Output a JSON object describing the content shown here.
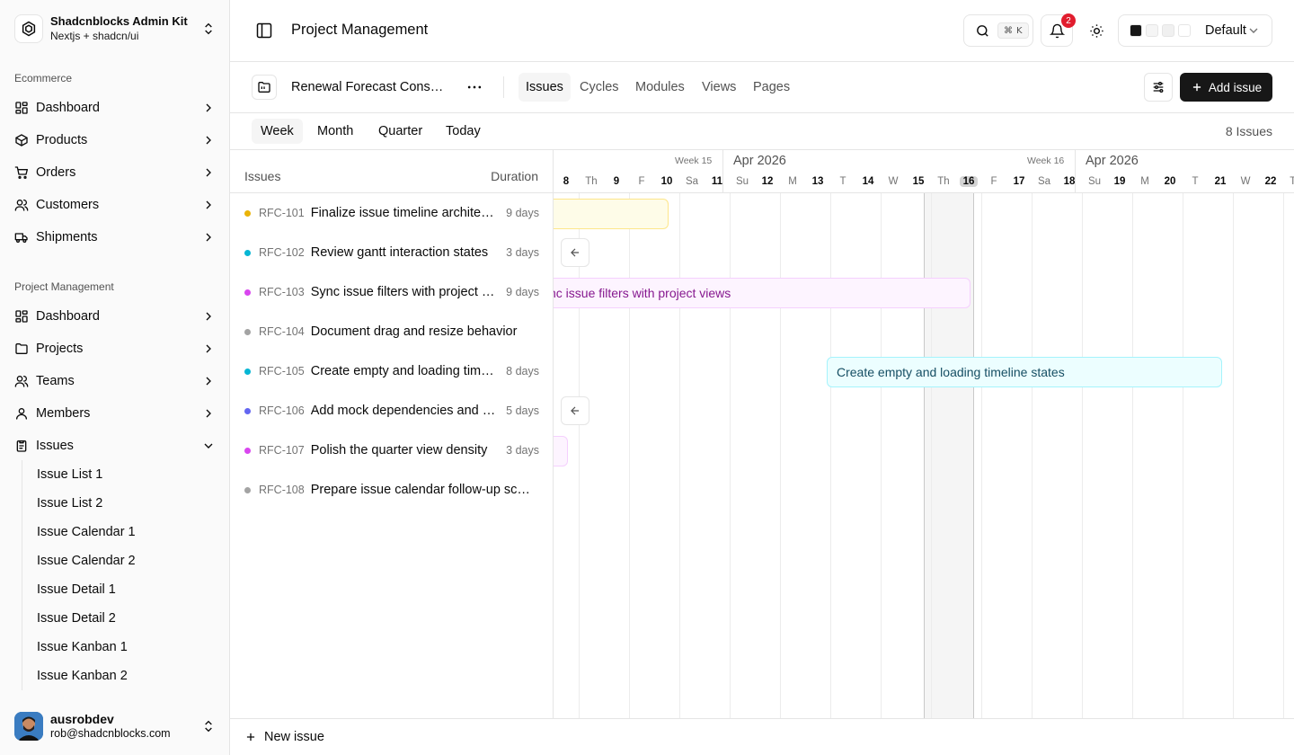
{
  "brand": {
    "title": "Shadcnblocks Admin Kit",
    "subtitle": "Nextjs + shadcn/ui"
  },
  "sidebar": {
    "section1": "Ecommerce",
    "ecommerce": [
      {
        "label": "Dashboard",
        "icon": "layout-dashboard-icon"
      },
      {
        "label": "Products",
        "icon": "package-icon"
      },
      {
        "label": "Orders",
        "icon": "cart-icon"
      },
      {
        "label": "Customers",
        "icon": "users-icon"
      },
      {
        "label": "Shipments",
        "icon": "truck-icon"
      }
    ],
    "section2": "Project Management",
    "pm": [
      {
        "label": "Dashboard",
        "icon": "layout-dashboard-icon"
      },
      {
        "label": "Projects",
        "icon": "folder-icon"
      },
      {
        "label": "Teams",
        "icon": "users-icon"
      },
      {
        "label": "Members",
        "icon": "user-icon"
      },
      {
        "label": "Issues",
        "icon": "clipboard-icon"
      }
    ],
    "issues_sub": [
      "Issue List 1",
      "Issue List 2",
      "Issue Calendar 1",
      "Issue Calendar 2",
      "Issue Detail 1",
      "Issue Detail 2",
      "Issue Kanban 1",
      "Issue Kanban 2"
    ]
  },
  "user": {
    "name": "ausrobdev",
    "email": "rob@shadcnblocks.com"
  },
  "header": {
    "title": "Project Management",
    "kbd_cmd": "⌘",
    "kbd_key": "K",
    "notifications": "2",
    "theme": "Default",
    "swatches": [
      "#171717",
      "#f5f5f5",
      "#f0f0f0",
      "#ffffff"
    ]
  },
  "project": {
    "name": "Renewal Forecast Consolidation",
    "tabs": [
      "Issues",
      "Cycles",
      "Modules",
      "Views",
      "Pages"
    ],
    "add_label": "Add issue"
  },
  "views": {
    "options": [
      "Week",
      "Month",
      "Quarter",
      "Today"
    ],
    "count": "8 Issues"
  },
  "list": {
    "col_issues": "Issues",
    "col_duration": "Duration",
    "rows": [
      {
        "key": "RFC-101",
        "title": "Finalize issue timeline architecture",
        "duration": "9 days",
        "color": "#eab308"
      },
      {
        "key": "RFC-102",
        "title": "Review gantt interaction states",
        "duration": "3 days",
        "color": "#06b6d4"
      },
      {
        "key": "RFC-103",
        "title": "Sync issue filters with project views",
        "duration": "9 days",
        "color": "#d946ef"
      },
      {
        "key": "RFC-104",
        "title": "Document drag and resize behavior",
        "duration": "",
        "color": "#a3a3a3"
      },
      {
        "key": "RFC-105",
        "title": "Create empty and loading timeline states",
        "duration": "8 days",
        "color": "#06b6d4"
      },
      {
        "key": "RFC-106",
        "title": "Add mock dependencies and handoffs",
        "duration": "5 days",
        "color": "#6366f1"
      },
      {
        "key": "RFC-107",
        "title": "Polish the quarter view density",
        "duration": "3 days",
        "color": "#d946ef"
      },
      {
        "key": "RFC-108",
        "title": "Prepare issue calendar follow-up screens",
        "duration": "",
        "color": "#a3a3a3"
      }
    ]
  },
  "timeline": {
    "weeks": [
      {
        "week": "Week 15",
        "month": "Apr 2026"
      },
      {
        "week": "Week 16",
        "month": "Apr 2026"
      }
    ],
    "days": [
      {
        "lbl": "",
        "num": "8"
      },
      {
        "lbl": "Th",
        "num": "9"
      },
      {
        "lbl": "F",
        "num": "10"
      },
      {
        "lbl": "Sa",
        "num": "11"
      },
      {
        "lbl": "Su",
        "num": "12"
      },
      {
        "lbl": "M",
        "num": "13"
      },
      {
        "lbl": "T",
        "num": "14"
      },
      {
        "lbl": "W",
        "num": "15"
      },
      {
        "lbl": "Th",
        "num": "16"
      },
      {
        "lbl": "F",
        "num": "17"
      },
      {
        "lbl": "Sa",
        "num": "18"
      },
      {
        "lbl": "Su",
        "num": "19"
      },
      {
        "lbl": "M",
        "num": "20"
      },
      {
        "lbl": "T",
        "num": "21"
      },
      {
        "lbl": "W",
        "num": "22"
      },
      {
        "lbl": "Th",
        "num": ""
      }
    ],
    "bar_labels": {
      "rfc103": "nc issue filters with project views",
      "rfc105": "Create empty and loading timeline states",
      "rfc107": "."
    }
  },
  "footer": {
    "new_issue": "New issue"
  }
}
